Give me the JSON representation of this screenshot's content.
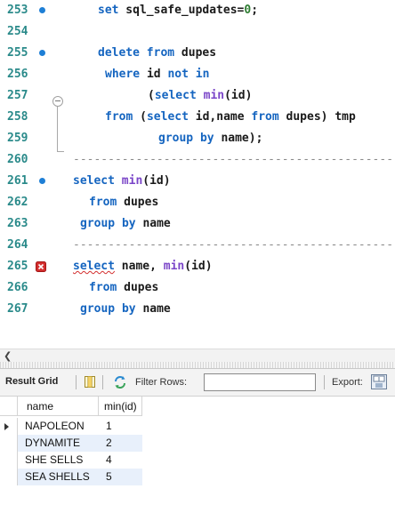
{
  "editor": {
    "lines": [
      {
        "num": "253",
        "marker": "dot"
      },
      {
        "num": "254",
        "marker": ""
      },
      {
        "num": "255",
        "marker": "dot"
      },
      {
        "num": "256",
        "marker": ""
      },
      {
        "num": "257",
        "marker": ""
      },
      {
        "num": "258",
        "marker": ""
      },
      {
        "num": "259",
        "marker": ""
      },
      {
        "num": "260",
        "marker": ""
      },
      {
        "num": "261",
        "marker": "dot"
      },
      {
        "num": "262",
        "marker": ""
      },
      {
        "num": "263",
        "marker": ""
      },
      {
        "num": "264",
        "marker": ""
      },
      {
        "num": "265",
        "marker": "error"
      },
      {
        "num": "266",
        "marker": ""
      },
      {
        "num": "267",
        "marker": ""
      }
    ],
    "code": {
      "l253_kw": "set",
      "l253_rest": " sql_safe_updates=",
      "l253_num": "0",
      "l253_end": ";",
      "l255_kw1": "delete",
      "l255_kw2": "from",
      "l255_rest": " dupes",
      "l256_kw1": "where",
      "l256_mid": " id ",
      "l256_kw2": "not in",
      "l257_open": "(",
      "l257_kw": "select",
      "l257_fn": " min",
      "l257_rest": "(id)",
      "l258_kw1": "from",
      "l258_open": " (",
      "l258_kw2": "select",
      "l258_mid": " id,name ",
      "l258_kw3": "from",
      "l258_rest": " dupes) tmp",
      "l259_kw": "group by",
      "l259_rest": " name);",
      "dashes": "--------------------------------------------------",
      "l261_kw": "select",
      "l261_fn": " min",
      "l261_rest": "(id)",
      "l262_kw": "from",
      "l262_rest": " dupes",
      "l263_kw": "group by",
      "l263_rest": " name",
      "l265_kw": "select",
      "l265_rest": " name, ",
      "l265_fn": "min",
      "l265_end": "(id)",
      "l266_kw": "from",
      "l266_rest": " dupes",
      "l267_kw": "group by",
      "l267_rest": " name"
    }
  },
  "toolbar": {
    "result_grid_label": "Result Grid",
    "filter_label": "Filter Rows:",
    "filter_value": "",
    "export_label": "Export:"
  },
  "grid": {
    "columns": [
      "name",
      "min(id)"
    ],
    "rows": [
      {
        "name": "NAPOLEON",
        "min_id": "1"
      },
      {
        "name": "DYNAMITE",
        "min_id": "2"
      },
      {
        "name": "SHE SELLS",
        "min_id": "4"
      },
      {
        "name": "SEA SHELLS",
        "min_id": "5"
      }
    ]
  },
  "colors": {
    "keyword": "#1565c0",
    "function": "#7a45c8",
    "number": "#2e7d32",
    "line_number": "#2a8a8a",
    "breakpoint_dot": "#1e7fd6",
    "error_marker": "#d32f2f",
    "alt_row": "#e8f0fb"
  }
}
